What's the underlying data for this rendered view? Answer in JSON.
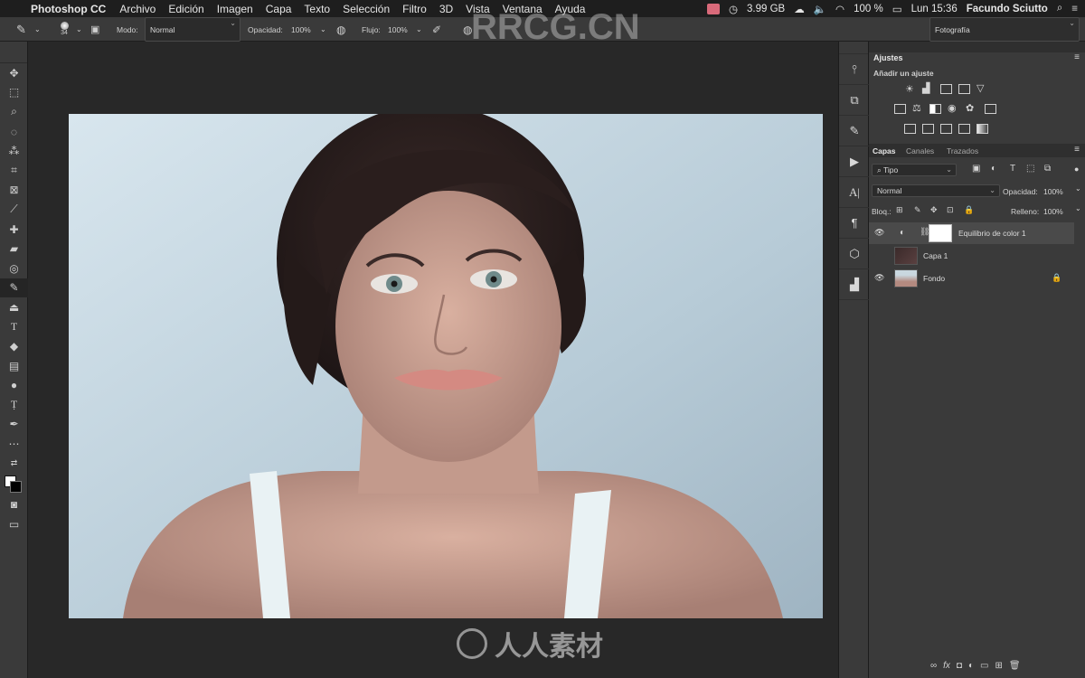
{
  "menubar": {
    "apple_icon": "apple-logo",
    "app_name": "Photoshop CC",
    "items": [
      "Archivo",
      "Edición",
      "Imagen",
      "Capa",
      "Texto",
      "Selección",
      "Filtro",
      "3D",
      "Vista",
      "Ventana",
      "Ayuda"
    ],
    "memory": "3.99 GB",
    "battery": "100 %",
    "clock": "Lun 15:36",
    "user": "Facundo Sciutto"
  },
  "options_bar": {
    "brush_size": "34",
    "mode_label": "Modo:",
    "mode_value": "Normal",
    "opacity_label": "Opacidad:",
    "opacity_value": "100%",
    "flow_label": "Flujo:",
    "flow_value": "100%",
    "workspace": "Fotografía"
  },
  "adjustments_panel": {
    "title": "Ajustes",
    "subtitle": "Añadir un ajuste"
  },
  "layers_panel": {
    "tabs": [
      "Capas",
      "Canales",
      "Trazados"
    ],
    "filter_label": "Tipo",
    "blend_mode": "Normal",
    "opacity_label": "Opacidad:",
    "opacity_value": "100%",
    "lock_label": "Bloq.:",
    "fill_label": "Relleno:",
    "fill_value": "100%",
    "layers": [
      {
        "name": "Equilibrio de color 1",
        "visible": true
      },
      {
        "name": "Capa 1",
        "visible": false
      },
      {
        "name": "Fondo",
        "visible": true
      }
    ]
  },
  "watermarks": {
    "top": "RRCG.CN",
    "bottom": "人人素材"
  }
}
